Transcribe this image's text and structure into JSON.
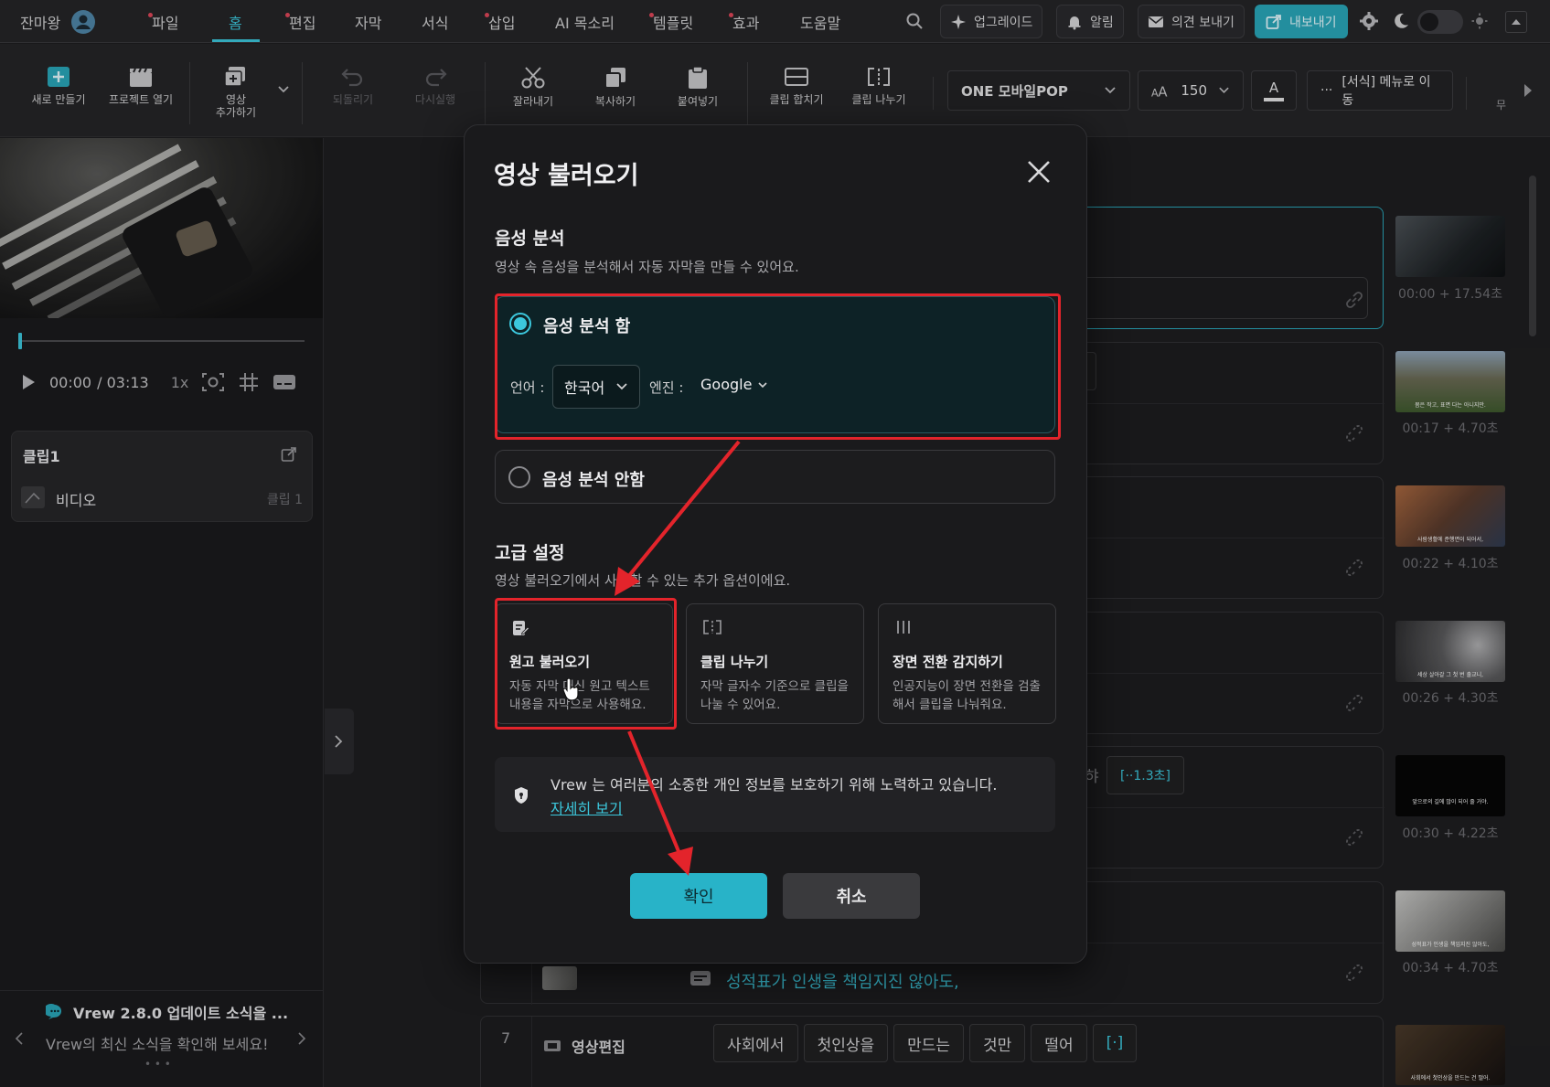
{
  "user": {
    "name": "잔마왕"
  },
  "menu": [
    {
      "label": "파일",
      "dot": true
    },
    {
      "label": "홈",
      "dot": false,
      "active": true
    },
    {
      "label": "편집",
      "dot": true
    },
    {
      "label": "자막",
      "dot": false
    },
    {
      "label": "서식",
      "dot": false
    },
    {
      "label": "삽입",
      "dot": true
    },
    {
      "label": "AI 목소리",
      "dot": false
    },
    {
      "label": "템플릿",
      "dot": true
    },
    {
      "label": "효과",
      "dot": true
    },
    {
      "label": "도움말",
      "dot": false
    }
  ],
  "topbar": {
    "upgrade": "업그레이드",
    "alarm": "알림",
    "feedback": "의견 보내기",
    "export": "내보내기"
  },
  "toolbar": {
    "new": "새로 만들기",
    "open": "프로젝트 열기",
    "add_video_line1": "영상",
    "add_video_line2": "추가하기",
    "undo": "되돌리기",
    "redo": "다시실행",
    "cut": "잘라내기",
    "copy": "복사하기",
    "paste": "붙여넣기",
    "merge": "클립 합치기",
    "split": "클립 나누기",
    "font": "ONE 모바일POP",
    "font_size": "150",
    "text_color_label": "A",
    "format_menu": "[서식] 메뉴로 이동",
    "overflow_label": "무"
  },
  "player": {
    "time_current": "00:00",
    "time_total": "/ 03:13",
    "speed": "1x"
  },
  "clipcard": {
    "title": "클립1",
    "item_label": "비디오",
    "item_meta": "클립 1"
  },
  "news": {
    "title": "Vrew 2.8.0 업데이트 소식을 ...",
    "subtitle": "Vrew의 최신 소식을 확인해 보세요!",
    "pager": "• • •"
  },
  "editor": {
    "thumbs": [
      {
        "time": "00:00 + 17.54초",
        "caption": ""
      },
      {
        "time": "00:17 + 4.70초",
        "caption": "몸은 작고, 표면 다는 아니지만."
      },
      {
        "time": "00:22 + 4.10초",
        "caption": "사람생활에 준행면이 되어서,"
      },
      {
        "time": "00:26 + 4.30초",
        "caption": "세상 살아갈 그 첫 번 출교니,"
      },
      {
        "time": "00:30 + 4.22초",
        "caption": "앞으로의 길에 많이 되어 줄 거야."
      },
      {
        "time": "00:34 + 4.70초",
        "caption": "성적표가 인생을 책임지진 않아도,"
      },
      {
        "time": "",
        "caption": "사회에서 첫인상을 만드는 건 떨어."
      }
    ],
    "row3_chip": "]",
    "row6_chip": "[··1.3초]",
    "row6_left_char": "햐",
    "row6_subtitle": "성적표가 인생을 책임지진 않아도,",
    "row7": {
      "number": "7",
      "label": "영상편집",
      "words": [
        "사회에서",
        "첫인상을",
        "만드는",
        "것만",
        "떨어",
        "[·]"
      ]
    }
  },
  "modal": {
    "title": "영상 불러오기",
    "voice_section_title": "음성 분석",
    "voice_section_desc": "영상 속 음성을 분석해서 자동 자막을 만들 수 있어요.",
    "option_on": "음성 분석 함",
    "lang_label": "언어 :",
    "lang_value": "한국어",
    "engine_label": "엔진 :",
    "engine_value": "Google",
    "option_off": "음성 분석 안함",
    "advanced_title": "고급 설정",
    "advanced_desc": "영상 불러오기에서 사용할 수 있는 추가 옵션이에요.",
    "cards": [
      {
        "title": "원고 불러오기",
        "desc": "자동 자막 대신 원고 텍스트 내용을 자막으로 사용해요."
      },
      {
        "title": "클립 나누기",
        "desc": "자막 글자수 기준으로 클립을 나눌 수 있어요."
      },
      {
        "title": "장면 전환 감지하기",
        "desc": "인공지능이 장면 전환을 검출해서 클립을 나눠줘요."
      }
    ],
    "privacy_text": "Vrew 는 여러분의 소중한 개인 정보를 보호하기 위해 노력하고 있습니다.",
    "privacy_link": "자세히 보기",
    "confirm": "확인",
    "cancel": "취소"
  },
  "colors": {
    "accent": "#3cc7dc",
    "annotation_red": "#e3242b",
    "background": "#1e1e20"
  }
}
